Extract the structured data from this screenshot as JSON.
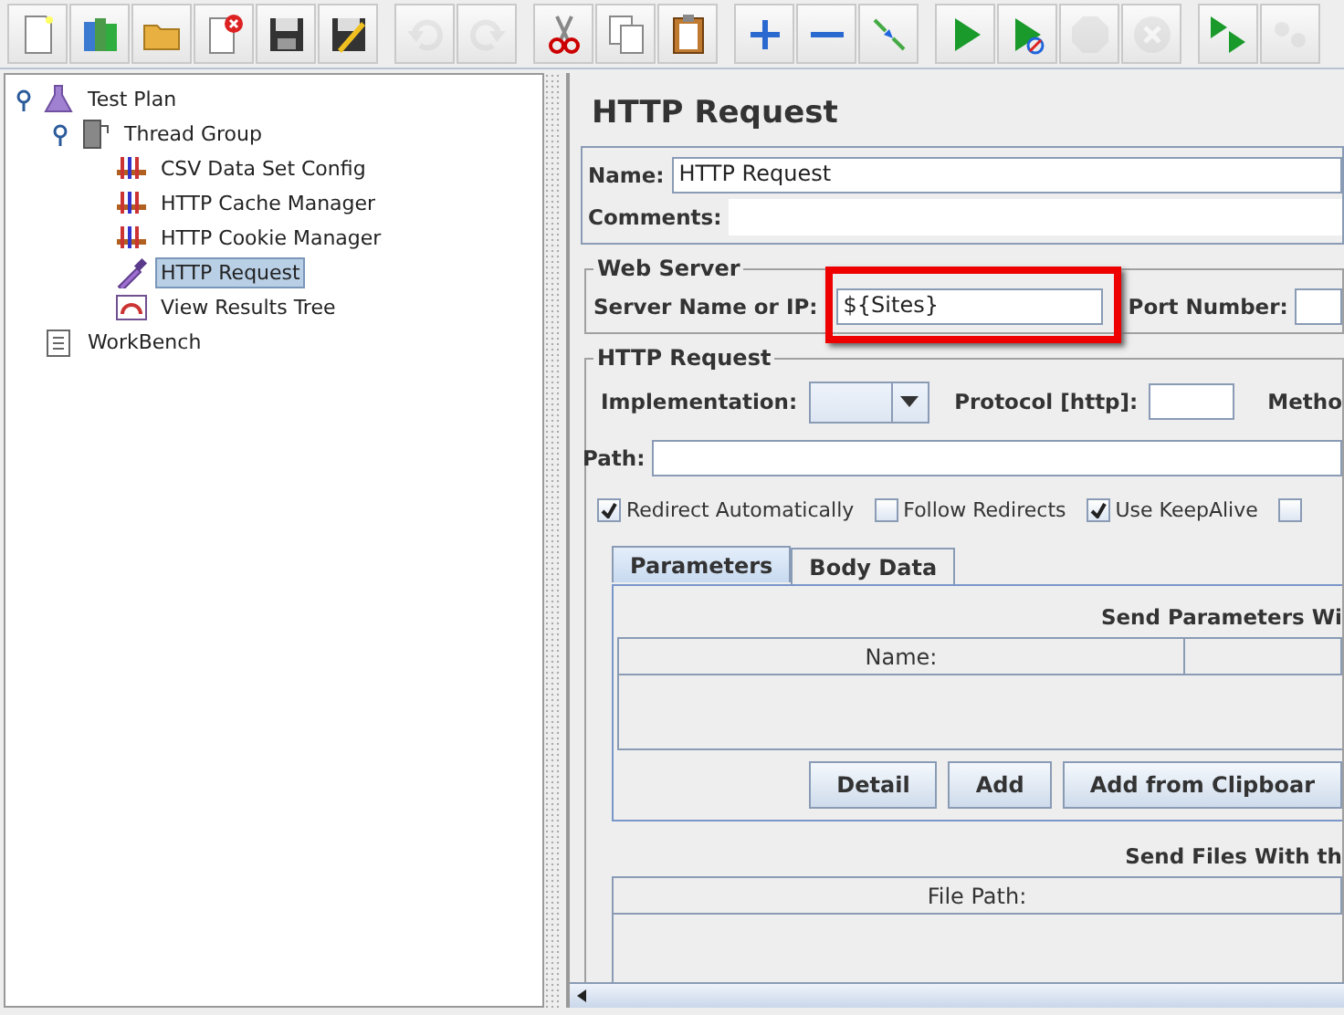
{
  "toolbar": [
    {
      "kind": "new",
      "disabled": false
    },
    {
      "kind": "templates",
      "disabled": false
    },
    {
      "kind": "open",
      "disabled": false
    },
    {
      "kind": "close",
      "disabled": false
    },
    {
      "kind": "save",
      "disabled": false
    },
    {
      "kind": "save-as",
      "disabled": false
    },
    {
      "kind": "undo",
      "disabled": true
    },
    {
      "kind": "redo",
      "disabled": true
    },
    {
      "kind": "cut",
      "disabled": false
    },
    {
      "kind": "copy",
      "disabled": false
    },
    {
      "kind": "paste",
      "disabled": false
    },
    {
      "kind": "expand",
      "disabled": false
    },
    {
      "kind": "collapse",
      "disabled": false
    },
    {
      "kind": "toggle",
      "disabled": false
    },
    {
      "kind": "start",
      "disabled": false
    },
    {
      "kind": "start-no-pause",
      "disabled": false
    },
    {
      "kind": "stop",
      "disabled": true
    },
    {
      "kind": "shutdown",
      "disabled": true
    },
    {
      "kind": "remote-start",
      "disabled": false
    },
    {
      "kind": "remote",
      "disabled": true
    }
  ],
  "tree": [
    {
      "label": "Test Plan",
      "kind": "plan",
      "expanded": true,
      "selected": false,
      "children": [
        {
          "label": "Thread Group",
          "kind": "threads",
          "expanded": true,
          "selected": false,
          "children": [
            {
              "label": "CSV Data Set Config",
              "kind": "config",
              "selected": false
            },
            {
              "label": "HTTP Cache Manager",
              "kind": "config",
              "selected": false
            },
            {
              "label": "HTTP Cookie Manager",
              "kind": "config",
              "selected": false
            },
            {
              "label": "HTTP Request",
              "kind": "sampler",
              "selected": true
            },
            {
              "label": "View Results Tree",
              "kind": "listener",
              "selected": false
            }
          ]
        }
      ]
    },
    {
      "label": "WorkBench",
      "kind": "workbench",
      "selected": false
    }
  ],
  "panel": {
    "title": "HTTP Request",
    "name_label": "Name:",
    "name_value": "HTTP Request",
    "comments_label": "Comments:",
    "web_server": {
      "legend": "Web Server",
      "server_label": "Server Name or IP:",
      "server_value": "${Sites}",
      "highlighted": true,
      "port_label": "Port Number:"
    },
    "http_request": {
      "legend": "HTTP Request",
      "implementation_label": "Implementation:",
      "protocol_label": "Protocol [http]:",
      "method_label": "Metho",
      "path_label": "Path:",
      "options": [
        {
          "label": "Redirect Automatically",
          "checked": true
        },
        {
          "label": "Follow Redirects",
          "checked": false
        },
        {
          "label": "Use KeepAlive",
          "checked": true
        },
        {
          "checked": false
        }
      ]
    },
    "tabs": [
      {
        "label": "Parameters",
        "selected": true
      },
      {
        "label": "Body Data",
        "selected": false
      }
    ],
    "parameters": {
      "heading": "Send Parameters Wi",
      "columns": [
        "Name:"
      ],
      "buttons": [
        "Detail",
        "Add",
        "Add from Clipboar"
      ]
    },
    "files": {
      "heading": "Send Files With th",
      "columns": [
        "File Path:"
      ]
    }
  }
}
